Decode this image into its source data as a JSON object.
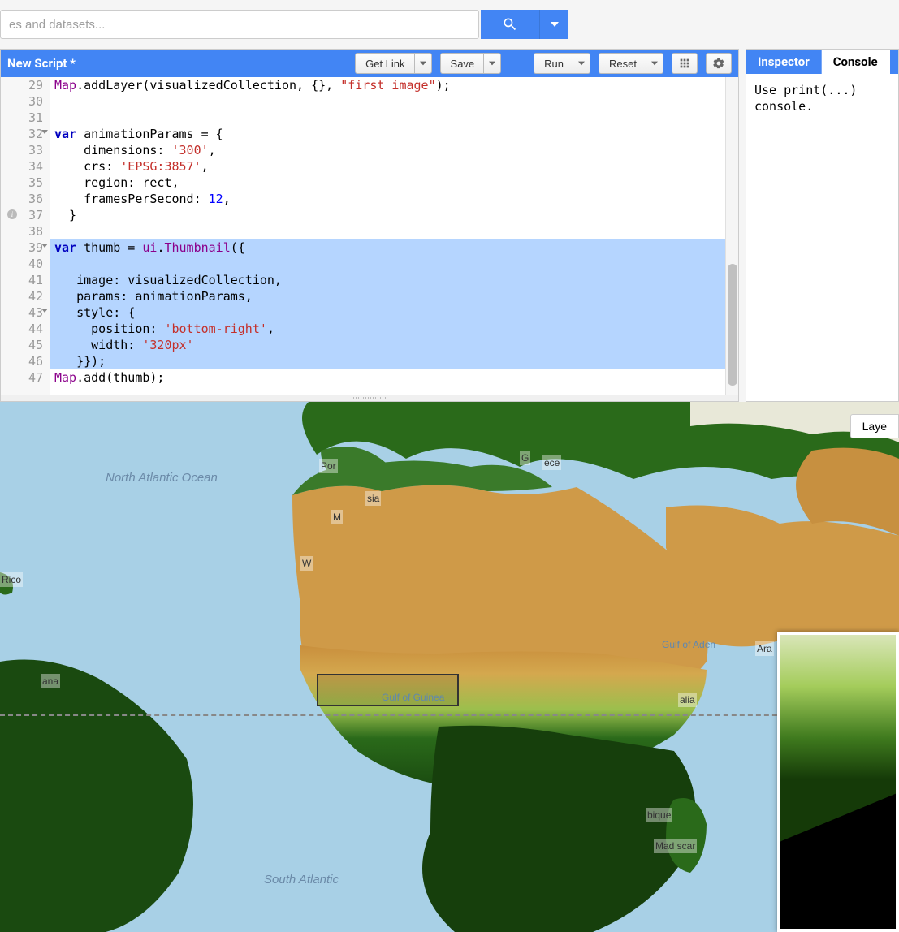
{
  "search": {
    "placeholder": "es and datasets..."
  },
  "editor": {
    "title": "New Script *",
    "buttons": {
      "getlink": "Get Link",
      "save": "Save",
      "run": "Run",
      "reset": "Reset"
    },
    "code": {
      "lines": [
        {
          "n": 29,
          "tokens": [
            [
              "obj",
              "Map"
            ],
            [
              "txt",
              ".addLayer(visualizedCollection, {}, "
            ],
            [
              "str",
              "\"first image\""
            ],
            [
              "txt",
              ");"
            ]
          ]
        },
        {
          "n": 30,
          "tokens": []
        },
        {
          "n": 31,
          "tokens": []
        },
        {
          "n": 32,
          "fold": true,
          "tokens": [
            [
              "kw",
              "var"
            ],
            [
              "txt",
              " animationParams = {"
            ]
          ]
        },
        {
          "n": 33,
          "tokens": [
            [
              "txt",
              "    dimensions: "
            ],
            [
              "str",
              "'300'"
            ],
            [
              "txt",
              ","
            ]
          ]
        },
        {
          "n": 34,
          "tokens": [
            [
              "txt",
              "    crs: "
            ],
            [
              "str",
              "'EPSG:3857'"
            ],
            [
              "txt",
              ","
            ]
          ]
        },
        {
          "n": 35,
          "tokens": [
            [
              "txt",
              "    region: rect,"
            ]
          ]
        },
        {
          "n": 36,
          "tokens": [
            [
              "txt",
              "    framesPerSecond: "
            ],
            [
              "num",
              "12"
            ],
            [
              "txt",
              ","
            ]
          ]
        },
        {
          "n": 37,
          "info": true,
          "tokens": [
            [
              "txt",
              "  }"
            ]
          ]
        },
        {
          "n": 38,
          "tokens": []
        },
        {
          "n": 39,
          "fold": true,
          "hl": true,
          "hlg": true,
          "tokens": [
            [
              "kw",
              "var"
            ],
            [
              "txt",
              " thumb = "
            ],
            [
              "prop",
              "ui"
            ],
            [
              "txt",
              "."
            ],
            [
              "prop",
              "Thumbnail"
            ],
            [
              "txt",
              "({"
            ]
          ]
        },
        {
          "n": 40,
          "hl": true,
          "tokens": []
        },
        {
          "n": 41,
          "hl": true,
          "tokens": [
            [
              "txt",
              "   image: visualizedCollection,"
            ]
          ]
        },
        {
          "n": 42,
          "hl": true,
          "tokens": [
            [
              "txt",
              "   params: animationParams,"
            ]
          ]
        },
        {
          "n": 43,
          "fold": true,
          "hl": true,
          "tokens": [
            [
              "txt",
              "   style: {"
            ]
          ]
        },
        {
          "n": 44,
          "hl": true,
          "tokens": [
            [
              "txt",
              "     position: "
            ],
            [
              "str",
              "'bottom-right'"
            ],
            [
              "txt",
              ","
            ]
          ]
        },
        {
          "n": 45,
          "hl": true,
          "tokens": [
            [
              "txt",
              "     width: "
            ],
            [
              "str",
              "'320px'"
            ]
          ]
        },
        {
          "n": 46,
          "hl": true,
          "tokens": [
            [
              "txt",
              "   }});"
            ]
          ]
        },
        {
          "n": 47,
          "tokens": [
            [
              "obj",
              "Map"
            ],
            [
              "txt",
              ".add(thumb);"
            ]
          ]
        }
      ]
    }
  },
  "rightpanel": {
    "tabs": {
      "inspector": "Inspector",
      "console": "Console"
    },
    "console_text": "Use print(...)\nconsole."
  },
  "map": {
    "layers_btn": "Laye",
    "labels": {
      "north_atlantic": "North\nAtlantic\nOcean",
      "south_atlantic": "South\nAtlantic",
      "portugal": "Por",
      "greece": "G",
      "ece": "ece",
      "sia": "sia",
      "m_short": "M",
      "w_short": "W",
      "rico": "Rico",
      "ana": "ana",
      "gulf_guinea": "Gulf of Guinea",
      "gulf_aden": "Gulf of Aden",
      "ara": "Ara",
      "alia": "alia",
      "bique": "bique",
      "madagascar": "Mad       scar"
    }
  }
}
